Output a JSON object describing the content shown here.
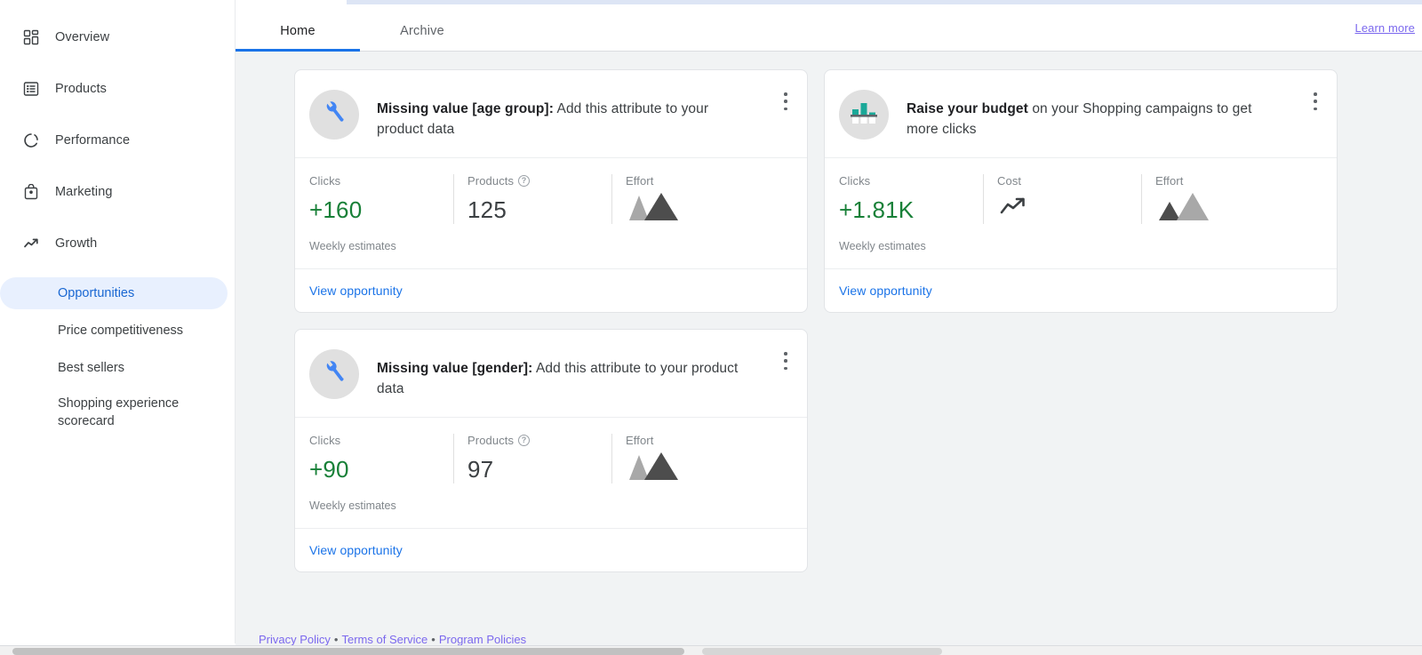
{
  "sidebar": {
    "items": [
      {
        "label": "Overview",
        "icon": "dashboard-icon"
      },
      {
        "label": "Products",
        "icon": "list-box-icon"
      },
      {
        "label": "Performance",
        "icon": "donut-chart-icon"
      },
      {
        "label": "Marketing",
        "icon": "shopping-bag-icon"
      },
      {
        "label": "Growth",
        "icon": "trending-up-icon"
      }
    ],
    "sub_items": [
      {
        "label": "Opportunities",
        "active": true
      },
      {
        "label": "Price competitiveness",
        "active": false
      },
      {
        "label": "Best sellers",
        "active": false
      },
      {
        "label": "Shopping experience scorecard",
        "active": false
      }
    ]
  },
  "header": {
    "tabs": [
      {
        "label": "Home",
        "active": true
      },
      {
        "label": "Archive",
        "active": false
      }
    ],
    "learn_more_label": "Learn more"
  },
  "cards": [
    {
      "icon": "wrench-icon",
      "title_bold": "Missing value [age group]:",
      "title_rest": " Add this attribute to your product data",
      "menu_icon": "more-vert-icon",
      "metrics": [
        {
          "label": "Clicks",
          "value": "+160",
          "value_style": "green",
          "help": false,
          "icon": null
        },
        {
          "label": "Products",
          "value": "125",
          "value_style": "plain",
          "help": true,
          "help_icon": "help-circle-icon",
          "icon": null
        },
        {
          "label": "Effort",
          "value": "",
          "value_style": "icon",
          "help": false,
          "icon": "effort-high-icon"
        }
      ],
      "footnote": "Weekly estimates",
      "action_label": "View opportunity"
    },
    {
      "icon": "bar-chart-icon",
      "title_bold": "Raise your budget",
      "title_rest": " on your Shopping campaigns to get more clicks",
      "menu_icon": "more-vert-icon",
      "metrics": [
        {
          "label": "Clicks",
          "value": "+1.81K",
          "value_style": "green",
          "help": false,
          "icon": null
        },
        {
          "label": "Cost",
          "value": "",
          "value_style": "icon",
          "help": false,
          "icon": "trending-up-icon"
        },
        {
          "label": "Effort",
          "value": "",
          "value_style": "icon",
          "help": false,
          "icon": "effort-low-icon"
        }
      ],
      "footnote": "Weekly estimates",
      "action_label": "View opportunity"
    },
    {
      "icon": "wrench-icon",
      "title_bold": "Missing value [gender]:",
      "title_rest": " Add this attribute to your product data",
      "menu_icon": "more-vert-icon",
      "metrics": [
        {
          "label": "Clicks",
          "value": "+90",
          "value_style": "green",
          "help": false,
          "icon": null
        },
        {
          "label": "Products",
          "value": "97",
          "value_style": "plain",
          "help": true,
          "help_icon": "help-circle-icon",
          "icon": null
        },
        {
          "label": "Effort",
          "value": "",
          "value_style": "icon",
          "help": false,
          "icon": "effort-high-icon"
        }
      ],
      "footnote": "Weekly estimates",
      "action_label": "View opportunity"
    }
  ],
  "footer": {
    "links": [
      "Privacy Policy",
      "Terms of Service",
      "Program Policies"
    ],
    "separator": "•"
  },
  "colors": {
    "accent_blue": "#1a73e8",
    "active_nav_bg": "#e8f0fe",
    "active_nav_text": "#1967d2",
    "positive_green": "#188038",
    "visited_link": "#7b68ee",
    "teal_bar": "#1aa898",
    "effort_dark": "#4d4d4d",
    "effort_light": "#a8a8a8",
    "page_bg": "#f1f3f4"
  }
}
